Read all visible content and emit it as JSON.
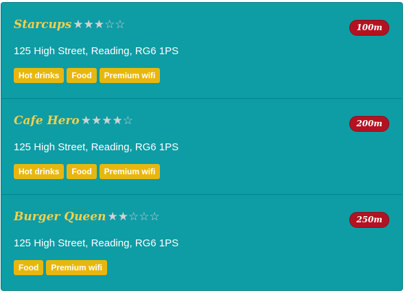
{
  "places": [
    {
      "name": "Starcups",
      "rating": 3,
      "rating_max": 5,
      "address": "125 High Street, Reading, RG6 1PS",
      "tags": [
        "Hot drinks",
        "Food",
        "Premium wifi"
      ],
      "distance": "100m"
    },
    {
      "name": "Cafe Hero",
      "rating": 4,
      "rating_max": 5,
      "address": "125 High Street, Reading, RG6 1PS",
      "tags": [
        "Hot drinks",
        "Food",
        "Premium wifi"
      ],
      "distance": "200m"
    },
    {
      "name": "Burger Queen",
      "rating": 2,
      "rating_max": 5,
      "address": "125 High Street, Reading, RG6 1PS",
      "tags": [
        "Food",
        "Premium wifi"
      ],
      "distance": "250m"
    }
  ],
  "colors": {
    "background": "#0e9ca5",
    "name": "#f2d04f",
    "tag": "#e8b70f",
    "distance_badge": "#b31321",
    "star": "#d2d2d2"
  }
}
